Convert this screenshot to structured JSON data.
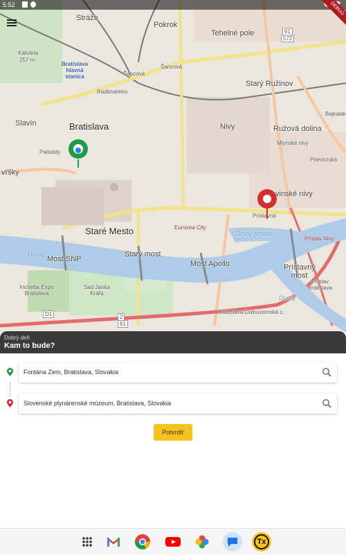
{
  "status_bar": {
    "time": "5:52"
  },
  "debug_banner": "DEBUG",
  "map": {
    "labels": {
      "straze": "Stráže",
      "pokrok": "Pokrok",
      "tehelne_pole": "Tehelné pole",
      "stary_ruzinov": "Starý Ružinov",
      "ruzova_dolina": "Ružová dolina",
      "bratislava": "Bratislava",
      "slavin": "Slavín",
      "nivy": "Nivy",
      "stare_mesto": "Staré Mesto",
      "kalvaria": "Kalvária",
      "kalvaria_elev": "257 m",
      "bratislava_hlavna": "Bratislava hlavná stanica",
      "sancova_1": "Šancová",
      "sancova_2": "Šancová",
      "radlinskeho": "Radlinského",
      "palisady": "Palisády",
      "vrsky": "vŕšky",
      "slovenske_nivy": "vinské nivy",
      "pristavna": "Prístavná",
      "prievozska": "Prievozská",
      "bajkalska": "Bajkalská",
      "mlynske_nivy": "Mlynské nivy",
      "eurovea": "Eurovea City",
      "zimny_pristav": "Zimný prístav",
      "kpl_bratislava": "Prístav Bratislava",
      "pristav_nivy": "Prístav Nivy",
      "most_snp": "Most SNP",
      "stary_most": "Starý most",
      "most_apollo": "Most Apollo",
      "pristavny_most": "Prístavný most",
      "dunaj_1": "Dunaj",
      "dunaj_2": "Dunaj",
      "incheba": "Incheba Expo Bratislava",
      "sad_janka_krala": "Sad Janka Kráľa",
      "pristav_bratislava2": "Prístav Bratislava",
      "bratislava_petrzalka": "Bratislava-Dolnozemská c.",
      "d1": "D1",
      "road_61": "61",
      "road_2": "2",
      "road_61b": "61",
      "road_572": "572"
    }
  },
  "sheet": {
    "greeting": "Dobrý deň",
    "prompt": "Kam to bude?"
  },
  "origin": {
    "value": "Fontána Zem, Bratislava, Slovakia",
    "color": "#1e9a4a"
  },
  "destination": {
    "value": "Slovenské plynárenské múzeum, Bratislava, Slovakia",
    "color": "#d32f2f"
  },
  "confirm_label": "Potvrdiť",
  "dock_apps": [
    "apps-grid",
    "gmail",
    "chrome",
    "youtube",
    "photos",
    "messages",
    "tx-app"
  ]
}
